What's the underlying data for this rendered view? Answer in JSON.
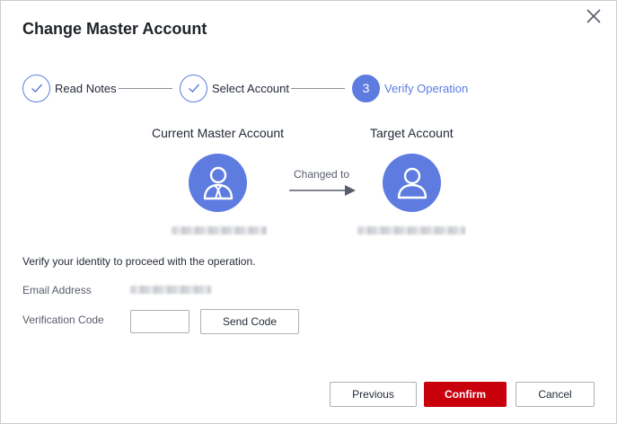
{
  "dialog": {
    "title": "Change Master Account",
    "close_icon": "close-icon"
  },
  "steps": [
    {
      "label": "Read Notes",
      "state": "done",
      "icon": "check-icon"
    },
    {
      "label": "Select Account",
      "state": "done",
      "icon": "check-icon"
    },
    {
      "label": "Verify Operation",
      "state": "active",
      "number": "3"
    }
  ],
  "accounts": {
    "current_title": "Current Master Account",
    "target_title": "Target Account",
    "changed_label": "Changed to",
    "current_icon": "user-tie-icon",
    "target_icon": "user-icon"
  },
  "form": {
    "intro": "Verify your identity to proceed with the operation.",
    "email_label": "Email Address",
    "code_label": "Verification Code",
    "code_value": "",
    "send_code_label": "Send Code"
  },
  "footer": {
    "previous_label": "Previous",
    "confirm_label": "Confirm",
    "cancel_label": "Cancel"
  },
  "colors": {
    "accent": "#5e7ce0",
    "primary_button": "#c7000b",
    "line": "#8a8e99"
  }
}
